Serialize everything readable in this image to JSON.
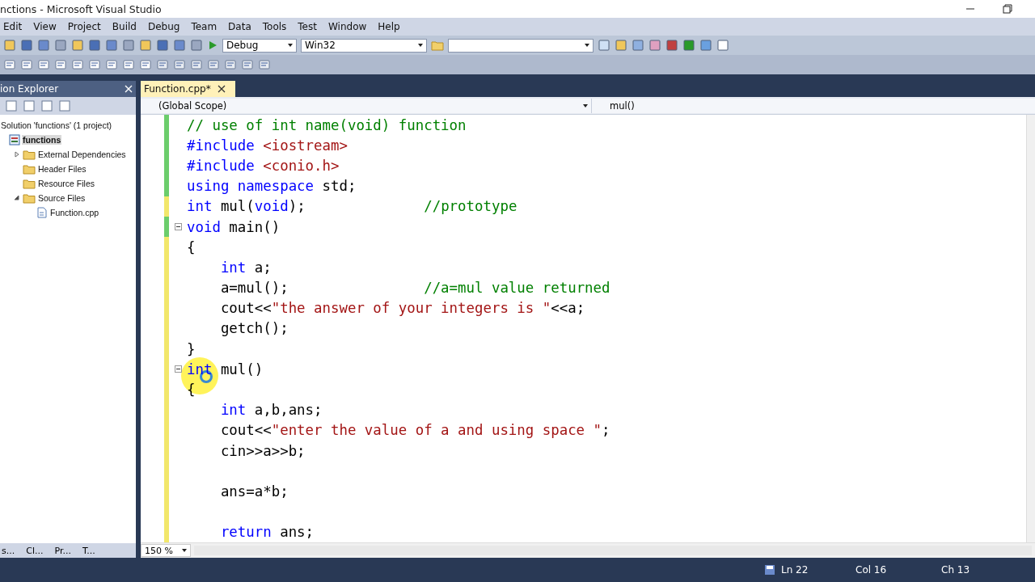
{
  "window": {
    "title": "nctions - Microsoft Visual Studio"
  },
  "menu": [
    "Edit",
    "View",
    "Project",
    "Build",
    "Debug",
    "Team",
    "Data",
    "Tools",
    "Test",
    "Window",
    "Help"
  ],
  "toolbar": {
    "configuration": "Debug",
    "platform": "Win32"
  },
  "solution_explorer": {
    "title": "ion Explorer",
    "tree": [
      {
        "label": "Solution 'functions' (1 project)",
        "selected": false,
        "children": [
          {
            "label": "functions",
            "kind": "project",
            "selected": true,
            "children": [
              {
                "label": "External Dependencies",
                "kind": "folder",
                "selected": false,
                "expanded": false
              },
              {
                "label": "Header Files",
                "kind": "folder",
                "selected": false
              },
              {
                "label": "Resource Files",
                "kind": "folder",
                "selected": false
              },
              {
                "label": "Source Files",
                "kind": "folder",
                "selected": false,
                "expanded": true,
                "children": [
                  {
                    "label": "Function.cpp",
                    "kind": "file",
                    "selected": false
                  }
                ]
              }
            ]
          }
        ]
      }
    ]
  },
  "bottom_tabs": [
    "s...",
    "Cl...",
    "Pr...",
    "T..."
  ],
  "editor": {
    "tab": {
      "label": "Function.cpp*"
    },
    "scope": "(Global Scope)",
    "member": "mul()",
    "zoom": "150 %",
    "lines": [
      {
        "saved": true,
        "segs": [
          {
            "t": "// use of int name(void) function",
            "color": "#008000"
          }
        ]
      },
      {
        "saved": true,
        "segs": [
          {
            "t": "#include",
            "color": "#0000ff"
          },
          {
            "t": " <iostream>",
            "color": "#a31515"
          }
        ]
      },
      {
        "saved": true,
        "segs": [
          {
            "t": "#include",
            "color": "#0000ff"
          },
          {
            "t": " <conio.h>",
            "color": "#a31515"
          }
        ]
      },
      {
        "saved": true,
        "segs": [
          {
            "t": "using namespace",
            "color": "#0000ff"
          },
          {
            "t": " std;",
            "color": "#000000"
          }
        ]
      },
      {
        "saved": false,
        "segs": [
          {
            "t": "int",
            "color": "#0000ff"
          },
          {
            "t": " mul(",
            "color": "#000000"
          },
          {
            "t": "void",
            "color": "#0000ff"
          },
          {
            "t": ");              ",
            "color": "#000000"
          },
          {
            "t": "//prototype",
            "color": "#008000"
          }
        ]
      },
      {
        "saved": true,
        "fold": true,
        "segs": [
          {
            "t": "void",
            "color": "#0000ff"
          },
          {
            "t": " main()",
            "color": "#000000"
          }
        ]
      },
      {
        "saved": false,
        "segs": [
          {
            "t": "{",
            "color": "#000000"
          }
        ]
      },
      {
        "saved": false,
        "segs": [
          {
            "t": "    int",
            "color": "#0000ff"
          },
          {
            "t": " a;",
            "color": "#000000"
          }
        ]
      },
      {
        "saved": false,
        "segs": [
          {
            "t": "    a=mul();                ",
            "color": "#000000"
          },
          {
            "t": "//a=mul value returned",
            "color": "#008000"
          }
        ]
      },
      {
        "saved": false,
        "segs": [
          {
            "t": "    cout<<",
            "color": "#000000"
          },
          {
            "t": "\"the answer of your integers is \"",
            "color": "#a31515"
          },
          {
            "t": "<<a;",
            "color": "#000000"
          }
        ]
      },
      {
        "saved": false,
        "segs": [
          {
            "t": "    getch();",
            "color": "#000000"
          }
        ]
      },
      {
        "saved": false,
        "segs": [
          {
            "t": "}",
            "color": "#000000"
          }
        ]
      },
      {
        "saved": false,
        "fold": true,
        "segs": [
          {
            "t": "int",
            "color": "#0000ff"
          },
          {
            "t": " mul()",
            "color": "#000000"
          }
        ]
      },
      {
        "saved": false,
        "segs": [
          {
            "t": "{",
            "color": "#000000"
          }
        ]
      },
      {
        "saved": false,
        "segs": [
          {
            "t": "    int",
            "color": "#0000ff"
          },
          {
            "t": " a,b,ans;",
            "color": "#000000"
          }
        ]
      },
      {
        "saved": false,
        "segs": [
          {
            "t": "    cout<<",
            "color": "#000000"
          },
          {
            "t": "\"enter the value of a and using space \"",
            "color": "#a31515"
          },
          {
            "t": ";",
            "color": "#000000"
          }
        ]
      },
      {
        "saved": false,
        "segs": [
          {
            "t": "    cin>>a>>b;",
            "color": "#000000"
          }
        ]
      },
      {
        "saved": false
      },
      {
        "saved": false,
        "segs": [
          {
            "t": "    ans=a*b;",
            "color": "#000000"
          }
        ]
      },
      {
        "saved": false
      },
      {
        "saved": false,
        "segs": [
          {
            "t": "    return",
            "color": "#0000ff"
          },
          {
            "t": " ans;",
            "color": "#000000"
          }
        ]
      }
    ]
  },
  "status_bar": {
    "line": "Ln 22",
    "column": "Col 16",
    "char": "Ch 13"
  }
}
